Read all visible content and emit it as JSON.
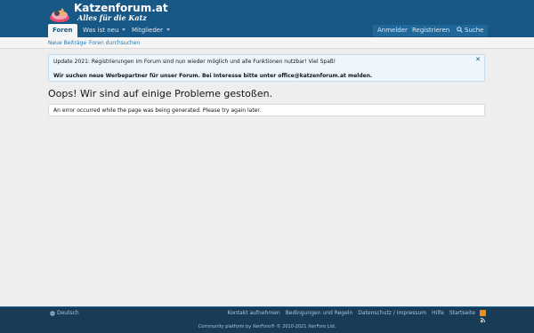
{
  "brand": {
    "title": "Katzenforum.at",
    "slogan": "Alles für die Katz"
  },
  "nav": {
    "tabs": [
      {
        "label": "Foren",
        "active": true
      },
      {
        "label": "Was ist neu",
        "active": false
      },
      {
        "label": "Mitglieder",
        "active": false
      }
    ],
    "login_label": "Anmelden",
    "register_label": "Registrieren",
    "search_label": "Suche"
  },
  "subnav": {
    "links": [
      "Neue Beiträge",
      "Foren durchsuchen"
    ]
  },
  "notice": {
    "line1": "Update 2021: Registrierungen im Forum sind nun wieder möglich und alle Funktionen nutzbar! Viel Spaß!",
    "line2": "Wir suchen neue Werbepartner für unser Forum. Bei Interesse bitte unter office@katzenforum.at melden.",
    "close_glyph": "✕"
  },
  "page": {
    "title": "Oops! Wir sind auf einige Probleme gestoßen.",
    "error_message": "An error occurred while the page was being generated. Please try again later."
  },
  "footer": {
    "language": "Deutsch",
    "links": [
      "Kontakt aufnehmen",
      "Bedingungen und Regeln",
      "Datenschutz / Impressum",
      "Hilfe",
      "Startseite"
    ],
    "copyright": "Community platform by XenForo® © 2010-2021 XenForo Ltd."
  },
  "colors": {
    "header": "#185886",
    "footer": "#183b56",
    "link": "#2577b1",
    "notice_bg": "#edf6fd",
    "rss": "#f38e1b"
  },
  "icons": {
    "logo": "cat-bed-logo-icon",
    "search": "search-icon",
    "language": "globe-icon",
    "feed": "rss-icon"
  }
}
